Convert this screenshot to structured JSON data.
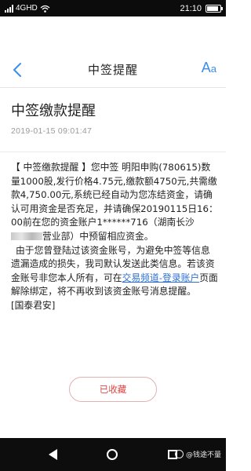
{
  "status_bar": {
    "network": "4GHD",
    "time": "21:10",
    "battery_level": 0.9
  },
  "nav": {
    "title": "中签提醒",
    "font_button_big": "A",
    "font_button_small": "a"
  },
  "message": {
    "title": "中签缴款提醒",
    "time": "2019-01-15 09:01:47",
    "body_part1": "【 中签缴款提醒 】您中签 明阳申购(780615)数量1000股,发行价格4.75元,缴款额4750元,共需缴款4,750.00元,系统已经自动为您冻结资金，请确认可用资金是否充足，并请确保20190115日16：00前在您的资金账户1******716（湖南长沙",
    "body_part2": "营业部）中预留相应资金。",
    "body_para2_part1": "由于您曾登陆过该资金账号，为避免中签等信息遗漏造成的损失，我司默认发送此类信息。若该资金账号非您本人所有，可在",
    "body_link": "交易频道-登录账户",
    "body_para2_part2": "页面解除绑定，将不再收到该资金账号消息提醒。",
    "signature": "[国泰君安]"
  },
  "favorite_button": "已收藏",
  "watermark": "@钱途不量"
}
